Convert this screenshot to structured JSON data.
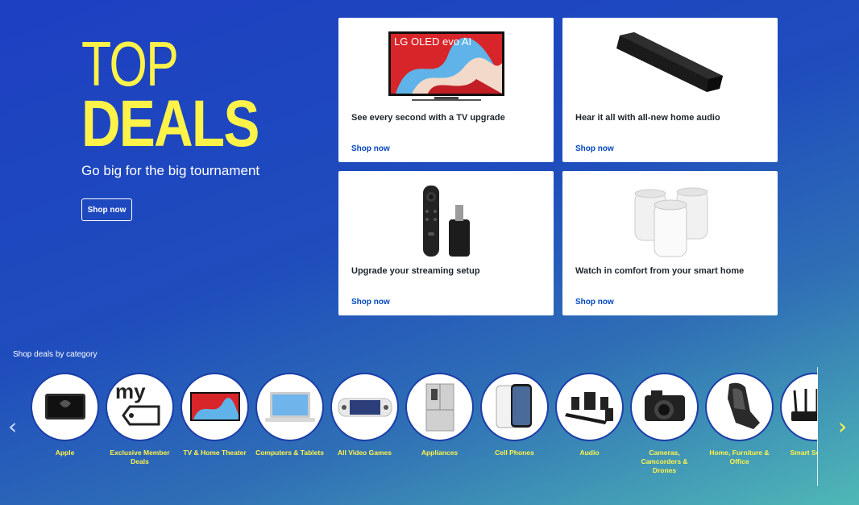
{
  "hero": {
    "title_line1": "TOP",
    "title_line2": "DEALS",
    "subtitle": "Go big for the big tournament",
    "button": "Shop now"
  },
  "cards": [
    {
      "title": "See every second with a TV upgrade",
      "link": "Shop now",
      "image_text": "LG OLED evo AI"
    },
    {
      "title": "Hear it all with all-new home audio",
      "link": "Shop now"
    },
    {
      "title": "Upgrade your streaming setup",
      "link": "Shop now"
    },
    {
      "title": "Watch in comfort from your smart home",
      "link": "Shop now"
    }
  ],
  "categories_heading": "Shop deals by category",
  "categories": [
    {
      "label": "Apple",
      "icon": "laptop-icon"
    },
    {
      "label": "Exclusive Member Deals",
      "icon": "my-tag-icon",
      "image_text": "my"
    },
    {
      "label": "TV & Home Theater",
      "icon": "tv-icon"
    },
    {
      "label": "Computers & Tablets",
      "icon": "laptop-icon"
    },
    {
      "label": "All Video Games",
      "icon": "handheld-console-icon"
    },
    {
      "label": "Appliances",
      "icon": "refrigerator-icon"
    },
    {
      "label": "Cell Phones",
      "icon": "phone-icon"
    },
    {
      "label": "Audio",
      "icon": "speakers-icon"
    },
    {
      "label": "Cameras, Camcorders & Drones",
      "icon": "camera-icon"
    },
    {
      "label": "Home, Furniture & Office",
      "icon": "massage-chair-icon"
    },
    {
      "label": "Smart Security",
      "icon": "router-icon"
    }
  ],
  "nav": {
    "prev": "‹",
    "next": "›"
  }
}
